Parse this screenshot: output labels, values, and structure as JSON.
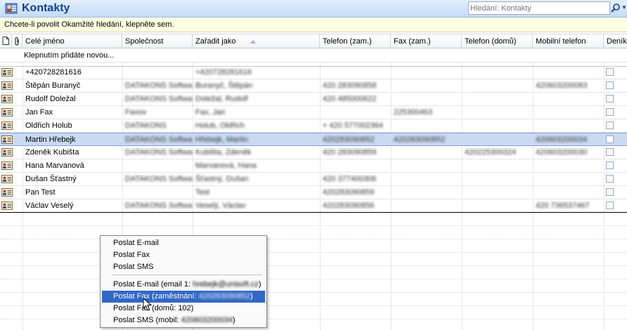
{
  "title": "Kontakty",
  "search": {
    "placeholder": "Hledání: Kontakty"
  },
  "infobar": "Chcete-li povolit Okamžité hledání, klepněte sem.",
  "columns": [
    "Celé jméno",
    "Společnost",
    "Zařadit jako",
    "Telefon (zam.)",
    "Fax (zam.)",
    "Telefon (domů)",
    "Mobilní telefon",
    "Deník"
  ],
  "click_to_add": "Klepnutím přidáte novou...",
  "rows": [
    {
      "name": "+420728281616",
      "company": "",
      "fileas": "+420728281616",
      "work": "",
      "fax": "",
      "home": "",
      "mobile": ""
    },
    {
      "name": "Štěpán Buranyč",
      "company": "DATAKONS Software...",
      "fileas": "Buranyč, Štěpán",
      "work": "420 283090858",
      "fax": "",
      "home": "",
      "mobile": "420603200083"
    },
    {
      "name": "Rudolf Doležal",
      "company": "DATAKONS Software...",
      "fileas": "Doležal, Rudolf",
      "work": "420 485000622",
      "fax": "",
      "home": "",
      "mobile": ""
    },
    {
      "name": "Jan Fax",
      "company": "Faxov",
      "fileas": "Fax, Jan",
      "work": "",
      "fax": "225300463",
      "home": "",
      "mobile": ""
    },
    {
      "name": "Oldřich Holub",
      "company": "DATAKONS",
      "fileas": "Holub, Oldřich",
      "work": "+ 420 577002364",
      "fax": "",
      "home": "",
      "mobile": ""
    },
    {
      "name": "Martin Hřebejk",
      "company": "DATAKONS Software...",
      "fileas": "Hřebejk, Martin",
      "work": "420283090852",
      "fax": "420283090852",
      "home": "",
      "mobile": "420603200034"
    },
    {
      "name": "Zdeněk Kubišta",
      "company": "DATAKONS Software...",
      "fileas": "Kubišta, Zdeněk",
      "work": "420 283090859",
      "fax": "",
      "home": "420225300324",
      "mobile": "420603200030"
    },
    {
      "name": "Hana Marvanová",
      "company": "",
      "fileas": "Marvanová, Hana",
      "work": "",
      "fax": "",
      "home": "",
      "mobile": ""
    },
    {
      "name": "Dušan Šťastný",
      "company": "DATAKONS Software...",
      "fileas": "Šťastný, Dušan",
      "work": "420 377400306",
      "fax": "",
      "home": "",
      "mobile": ""
    },
    {
      "name": "Pan Test",
      "company": "",
      "fileas": "Test",
      "work": "420283090859",
      "fax": "",
      "home": "",
      "mobile": ""
    },
    {
      "name": "Václav Veselý",
      "company": "DATAKONS Software...",
      "fileas": "Veselý, Václav",
      "work": "420283090856",
      "fax": "",
      "home": "",
      "mobile": "420 736537467"
    }
  ],
  "selected_row": 5,
  "context_menu": {
    "items_top": [
      "Poslat E-mail",
      "Poslat Fax",
      "Poslat SMS"
    ],
    "email1_prefix": "Poslat E-mail (email 1: ",
    "email1_value": "hrebejk@unisoft.cz",
    "email1_suffix": ")",
    "fax_prefix": "Poslat Fax (zaměstnání: ",
    "fax_value": "420283090852",
    "fax_suffix": ")",
    "faxhome": "Poslat Fax (domů: 102)",
    "sms_prefix": "Poslat SMS (mobil: ",
    "sms_value": "420603200034",
    "sms_suffix": ")"
  },
  "colors": {
    "accent": "#15428b",
    "selection": "#3167c5",
    "row_selected": "#c9daf2"
  }
}
